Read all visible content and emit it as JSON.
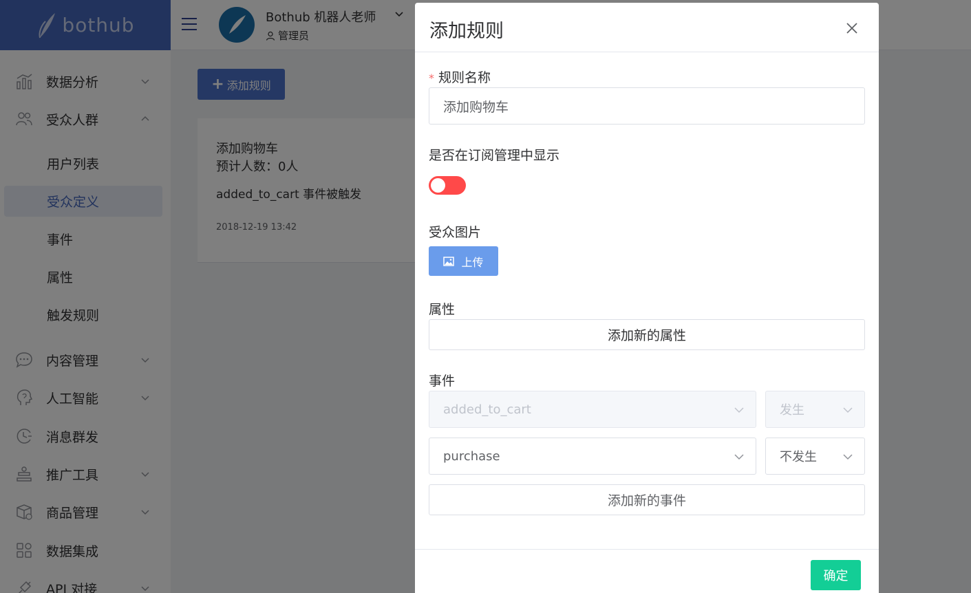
{
  "app": {
    "logo_text": "bothub",
    "brand_name": "Bothub 机器人老师",
    "role": "管理员"
  },
  "sidebar": {
    "items": [
      {
        "label": "数据分析",
        "icon": "chart-bar-icon",
        "expandable": true,
        "expanded": false
      },
      {
        "label": "受众人群",
        "icon": "users-icon",
        "expandable": true,
        "expanded": true
      },
      {
        "label": "内容管理",
        "icon": "chat-bubble-icon",
        "expandable": true,
        "expanded": false
      },
      {
        "label": "人工智能",
        "icon": "head-ai-icon",
        "expandable": true,
        "expanded": false
      },
      {
        "label": "消息群发",
        "icon": "clock-icon",
        "expandable": false,
        "expanded": false
      },
      {
        "label": "推广工具",
        "icon": "promotion-icon",
        "expandable": true,
        "expanded": false
      },
      {
        "label": "商品管理",
        "icon": "box-icon",
        "expandable": true,
        "expanded": false
      },
      {
        "label": "数据集成",
        "icon": "grid-icon",
        "expandable": false,
        "expanded": false
      },
      {
        "label": "API 对接",
        "icon": "plug-icon",
        "expandable": true,
        "expanded": false
      }
    ],
    "sub_items": [
      {
        "label": "用户列表",
        "active": false
      },
      {
        "label": "受众定义",
        "active": true
      },
      {
        "label": "事件",
        "active": false
      },
      {
        "label": "属性",
        "active": false
      },
      {
        "label": "触发规则",
        "active": false
      }
    ]
  },
  "main": {
    "add_rule_label": "添加规则",
    "rule_card": {
      "name": "添加购物车",
      "count": "预计人数：0人",
      "description": "added_to_cart 事件被触发",
      "time": "2018-12-19 13:42"
    }
  },
  "dialog": {
    "title": "添加规则",
    "rule_name_label": "规则名称",
    "rule_name_value": "添加购物车",
    "show_in_subscription_label": "是否在订阅管理中显示",
    "show_in_subscription": false,
    "audience_image_label": "受众图片",
    "upload_label": "上传",
    "attributes_label": "属性",
    "add_attribute_label": "添加新的属性",
    "events_label": "事件",
    "events": [
      {
        "event": "added_to_cart",
        "condition": "发生",
        "disabled": true
      },
      {
        "event": "purchase",
        "condition": "不发生",
        "disabled": false
      }
    ],
    "add_event_label": "添加新的事件",
    "confirm_label": "确定"
  },
  "colors": {
    "brand": "#4466bb",
    "primary_button": "#4a70c9",
    "upload_button": "#6a9ceb",
    "switch_off": "#ff4949",
    "confirm": "#13ce96"
  }
}
